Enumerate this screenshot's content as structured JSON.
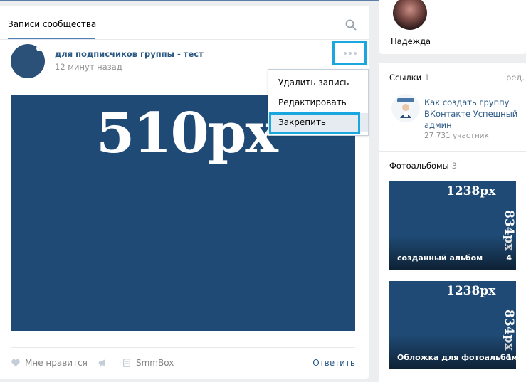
{
  "wall": {
    "tab_label": "Записи сообщества",
    "post": {
      "author": "для подписчиков группы - тест",
      "time": "12 минут назад",
      "image_text": "510px"
    },
    "menu": {
      "items": [
        "Удалить запись",
        "Редактировать",
        "Закрепить"
      ]
    },
    "actions": {
      "like": "Мне нравится",
      "smmbox": "SmmBox",
      "reply": "Ответить"
    }
  },
  "sidebar": {
    "friend_name": "Надежда",
    "links": {
      "title": "Ссылки",
      "count": "1",
      "edit_label": "ред.",
      "item_title": "Как создать группу ВКонтакте Успешный админ",
      "item_subtitle": "27 731 участник"
    },
    "albums": {
      "title": "Фотоальбомы",
      "count": "3",
      "items": [
        {
          "name": "созданный альбом",
          "count": "4",
          "width_text": "1238px",
          "height_text": "834px"
        },
        {
          "name": "Обложка для фотоальбома",
          "count": "1",
          "width_text": "1238px",
          "height_text": "834px"
        }
      ]
    }
  },
  "colors": {
    "accent": "#5181b8",
    "link": "#2a5885",
    "highlight": "#1aa7e0",
    "image_bg": "#1f4a75",
    "page_bg": "#edeef0"
  }
}
